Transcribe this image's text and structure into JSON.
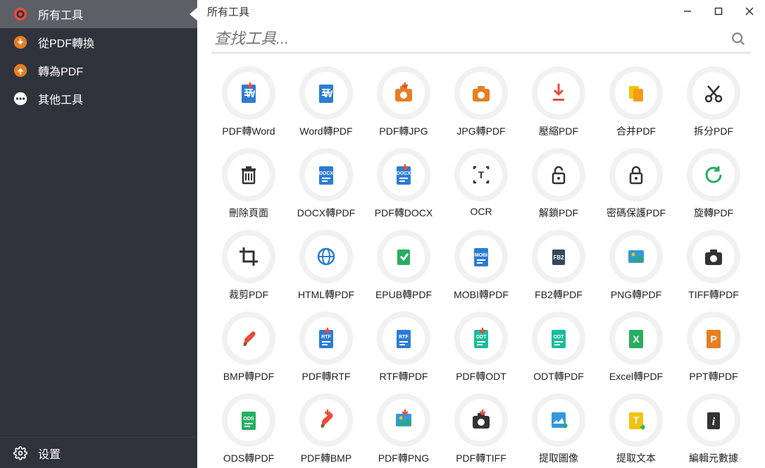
{
  "sidebar": {
    "items": [
      {
        "label": "所有工具",
        "active": true
      },
      {
        "label": "從PDF轉換",
        "active": false
      },
      {
        "label": "轉為PDF",
        "active": false
      },
      {
        "label": "其他工具",
        "active": false
      }
    ],
    "settings": "设置"
  },
  "header": {
    "title": "所有工具"
  },
  "search": {
    "placeholder": "查找工具..."
  },
  "tools": [
    {
      "label": "PDF轉Word",
      "icon": "word-down"
    },
    {
      "label": "Word轉PDF",
      "icon": "word"
    },
    {
      "label": "PDF轉JPG",
      "icon": "camera-down"
    },
    {
      "label": "JPG轉PDF",
      "icon": "camera"
    },
    {
      "label": "壓縮PDF",
      "icon": "compress"
    },
    {
      "label": "合并PDF",
      "icon": "merge"
    },
    {
      "label": "拆分PDF",
      "icon": "scissors"
    },
    {
      "label": "刪除頁面",
      "icon": "trash"
    },
    {
      "label": "DOCX轉PDF",
      "icon": "docx"
    },
    {
      "label": "PDF轉DOCX",
      "icon": "docx-down"
    },
    {
      "label": "OCR",
      "icon": "ocr"
    },
    {
      "label": "解鎖PDF",
      "icon": "unlock"
    },
    {
      "label": "密碼保護PDF",
      "icon": "lock"
    },
    {
      "label": "旋轉PDF",
      "icon": "rotate"
    },
    {
      "label": "裁剪PDF",
      "icon": "crop"
    },
    {
      "label": "HTML轉PDF",
      "icon": "globe"
    },
    {
      "label": "EPUB轉PDF",
      "icon": "epub"
    },
    {
      "label": "MOBI轉PDF",
      "icon": "mobi"
    },
    {
      "label": "FB2轉PDF",
      "icon": "fb2"
    },
    {
      "label": "PNG轉PDF",
      "icon": "image"
    },
    {
      "label": "TIFF轉PDF",
      "icon": "camera2"
    },
    {
      "label": "BMP轉PDF",
      "icon": "brush"
    },
    {
      "label": "PDF轉RTF",
      "icon": "rtf-down"
    },
    {
      "label": "RTF轉PDF",
      "icon": "rtf"
    },
    {
      "label": "PDF轉ODT",
      "icon": "odt-down"
    },
    {
      "label": "ODT轉PDF",
      "icon": "odt"
    },
    {
      "label": "Excel轉PDF",
      "icon": "excel"
    },
    {
      "label": "PPT轉PDF",
      "icon": "ppt"
    },
    {
      "label": "ODS轉PDF",
      "icon": "ods"
    },
    {
      "label": "PDF轉BMP",
      "icon": "brush-down"
    },
    {
      "label": "PDF轉PNG",
      "icon": "image-down"
    },
    {
      "label": "PDF轉TIFF",
      "icon": "camera2-down"
    },
    {
      "label": "提取圖像",
      "icon": "extract-img"
    },
    {
      "label": "提取文本",
      "icon": "extract-txt"
    },
    {
      "label": "編輯元數據",
      "icon": "info"
    }
  ]
}
